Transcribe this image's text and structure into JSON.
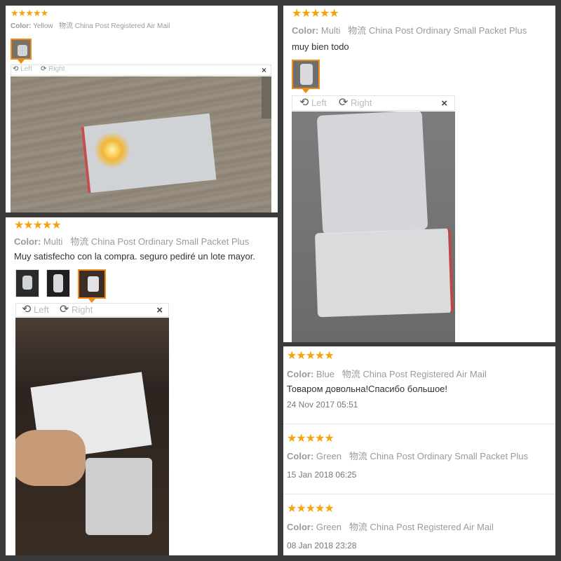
{
  "reviews": [
    {
      "stars": "★★★★★",
      "color_label": "Color:",
      "color": "Yellow",
      "logistics_label": "物流",
      "logistics": "China Post Registered Air Mail",
      "rotate_left": "Left",
      "rotate_right": "Right",
      "close": "×"
    },
    {
      "stars": "★★★★★",
      "color_label": "Color:",
      "color": "Multi",
      "logistics_label": "物流",
      "logistics": "China Post Ordinary Small Packet Plus",
      "text": "muy bien todo",
      "rotate_left": "Left",
      "rotate_right": "Right",
      "close": "×"
    },
    {
      "stars": "★★★★★",
      "color_label": "Color:",
      "color": "Multi",
      "logistics_label": "物流",
      "logistics": "China Post Ordinary Small Packet Plus",
      "text": "Muy satisfecho con la compra. seguro pediré un lote mayor.",
      "rotate_left": "Left",
      "rotate_right": "Right",
      "close": "×"
    },
    {
      "stars": "★★★★★",
      "color_label": "Color:",
      "color": "Blue",
      "logistics_label": "物流",
      "logistics": "China Post Registered Air Mail",
      "text": "Товаром довольна!Спасибо большое!",
      "date": "24 Nov 2017 05:51"
    },
    {
      "stars": "★★★★★",
      "color_label": "Color:",
      "color": "Green",
      "logistics_label": "物流",
      "logistics": "China Post Ordinary Small Packet Plus",
      "date": "15 Jan 2018 06:25"
    },
    {
      "stars": "★★★★★",
      "color_label": "Color:",
      "color": "Green",
      "logistics_label": "物流",
      "logistics": "China Post Registered Air Mail",
      "date": "08 Jan 2018 23:28"
    }
  ],
  "icons": {
    "rotate_left": "rotate-left-icon",
    "rotate_right": "rotate-right-icon",
    "close": "close-icon"
  },
  "colors": {
    "star": "#f5a40c",
    "active_thumb": "#f28a18",
    "meta": "#9a9a9a",
    "background": "#3a3a3a"
  }
}
